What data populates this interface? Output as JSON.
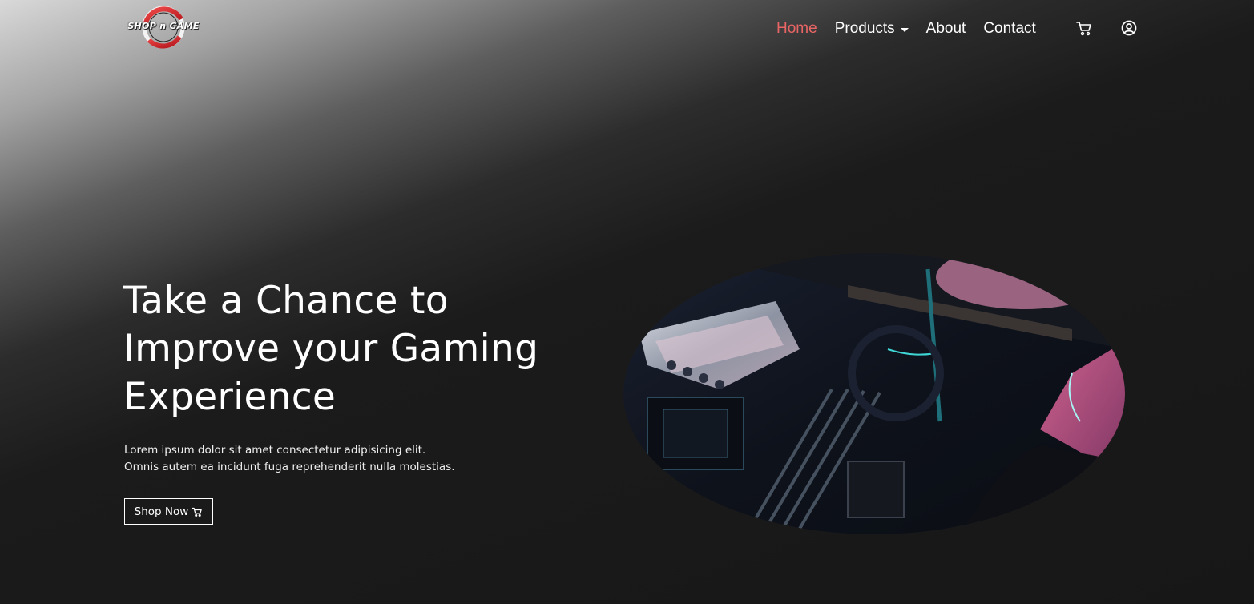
{
  "brand": {
    "logo_text": "SHOP n GAME",
    "accent_color": "#d32a2f"
  },
  "nav": {
    "home": "Home",
    "products": "Products",
    "about": "About",
    "contact": "Contact",
    "active_color": "#e86565",
    "cart_icon": "cart-icon",
    "user_icon": "user-circle-icon"
  },
  "hero": {
    "title_lines": [
      "Take a Chance to",
      "Improve your Gaming",
      "Experience"
    ],
    "text_lines": [
      "Lorem ipsum dolor sit amet consectetur adipisicing elit.",
      "Omnis autem ea incidunt fuga reprehenderit nulla molestias."
    ],
    "button_label": "Shop Now",
    "button_icon": "cart-icon",
    "image_icon": "pc-motherboard-image"
  }
}
